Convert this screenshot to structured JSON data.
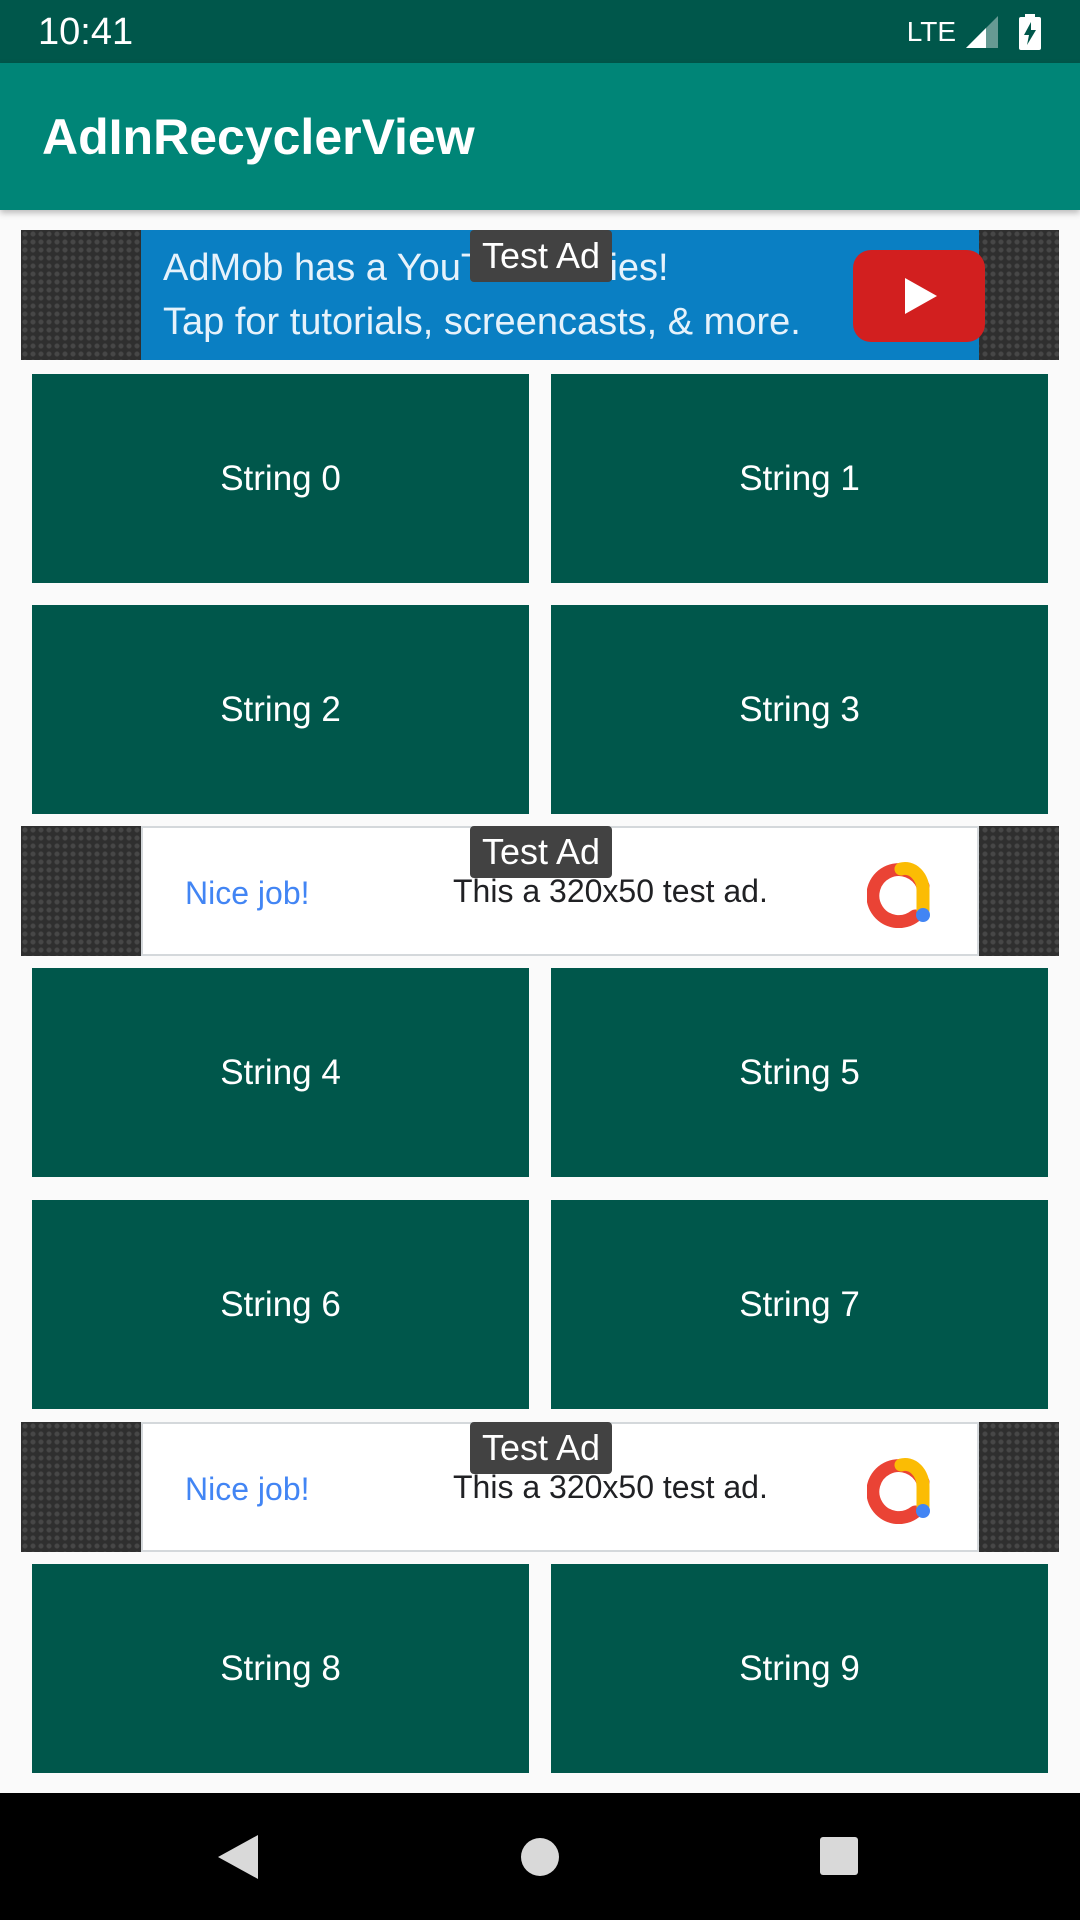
{
  "status_bar": {
    "time": "10:41",
    "network": "LTE"
  },
  "app_bar": {
    "title": "AdInRecyclerView"
  },
  "ads": {
    "badge": "Test Ad",
    "youtube": {
      "line1": "AdMob has a YouTube series!",
      "line2": "Tap for tutorials, screencasts, & more."
    },
    "banner": {
      "nice_job": "Nice job!",
      "text": "This a 320x50 test ad."
    }
  },
  "items": [
    "String 0",
    "String 1",
    "String 2",
    "String 3",
    "String 4",
    "String 5",
    "String 6",
    "String 7",
    "String 8",
    "String 9"
  ],
  "colors": {
    "status_bar": "#00574b",
    "app_bar": "#008577",
    "tile": "#00574b",
    "background": "#fafafa",
    "youtube_ad": "#0a7fc3",
    "nice_job": "#4285f4"
  },
  "icons": {
    "signal": "signal-icon",
    "battery": "battery-icon",
    "youtube": "youtube-play-icon",
    "admob": "admob-logo-icon",
    "back": "back-triangle-icon",
    "home": "home-circle-icon",
    "recents": "recents-square-icon"
  }
}
